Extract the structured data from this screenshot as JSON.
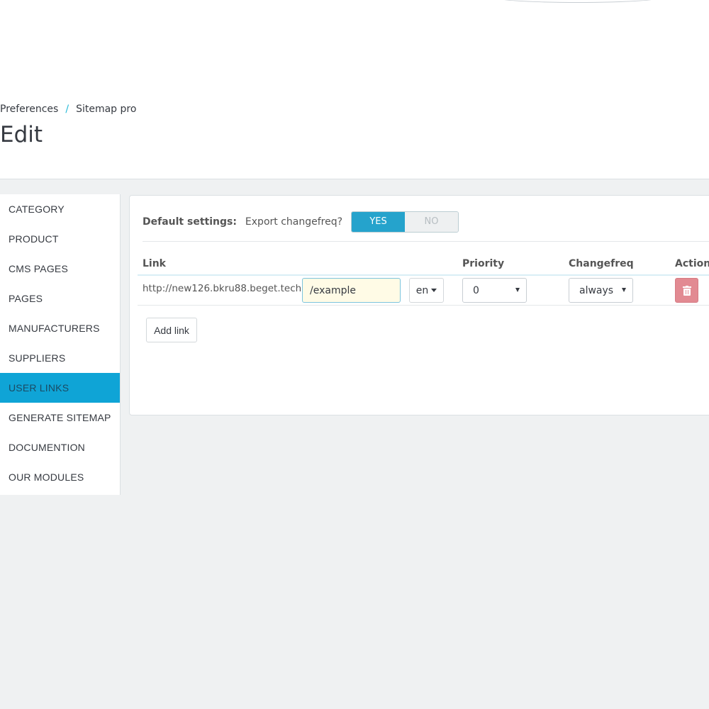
{
  "breadcrumb": {
    "items": [
      "Preferences",
      "Sitemap pro"
    ],
    "separator": "/"
  },
  "page_title": "Edit",
  "sidebar": {
    "items": [
      {
        "label": "CATEGORY"
      },
      {
        "label": "PRODUCT"
      },
      {
        "label": "CMS PAGES"
      },
      {
        "label": "PAGES"
      },
      {
        "label": "MANUFACTURERS"
      },
      {
        "label": "SUPPLIERS"
      },
      {
        "label": "USER LINKS",
        "active": true
      },
      {
        "label": "GENERATE SITEMAP"
      },
      {
        "label": "DOCUMENTION"
      },
      {
        "label": "OUR MODULES"
      }
    ]
  },
  "defaults": {
    "label": "Default settings:",
    "question": "Export changefreq?",
    "yes_label": "YES",
    "no_label": "NO",
    "selected": "YES"
  },
  "table": {
    "headers": {
      "link": "Link",
      "priority": "Priority",
      "changefreq": "Changefreq",
      "action": "Action"
    },
    "rows": [
      {
        "base_url": "http://new126.bkru88.beget.tech",
        "path": "/example",
        "language": "en",
        "priority": "0",
        "changefreq": "always"
      }
    ]
  },
  "add_link_label": "Add link",
  "colors": {
    "accent": "#25a3cc",
    "sidebar_active": "#0fa4d6",
    "delete": "#e28a92",
    "input_highlight": "#fffbe6"
  }
}
